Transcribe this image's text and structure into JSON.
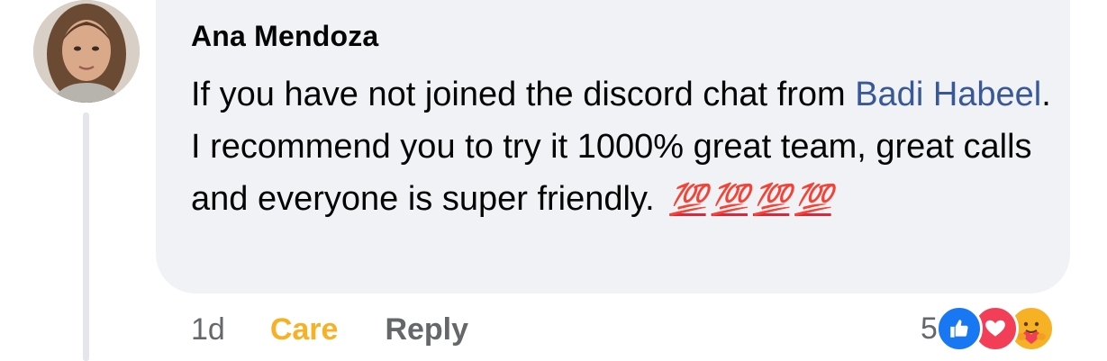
{
  "comment": {
    "author": "Ana Mendoza",
    "text_before_mention": "If you have not joined the discord chat from ",
    "mention": "Badi Habeel",
    "text_after_mention": ". I recommend you to try it 1000% great team, great calls and everyone is super friendly.",
    "emojis": [
      "💯",
      "💯",
      "💯",
      "💯"
    ],
    "emoji_icon": "hundred-points-icon"
  },
  "actions": {
    "timestamp": "1d",
    "care_label": "Care",
    "reply_label": "Reply"
  },
  "reactions": {
    "count": "5",
    "icons": [
      "like-icon",
      "love-icon",
      "care-icon"
    ],
    "colors": {
      "like": "#1877f2",
      "love": "#f33e58",
      "care": "#f7b125"
    }
  },
  "colors": {
    "bubble": "#f0f2f5",
    "mention": "#385898",
    "care_link": "#f7b125",
    "muted": "#65676b"
  }
}
